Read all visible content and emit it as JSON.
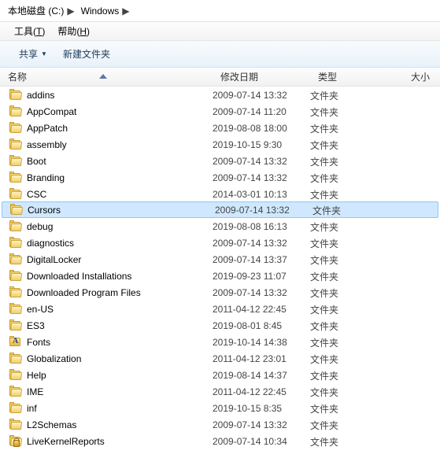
{
  "breadcrumb": {
    "seg1": "本地磁盘 (C:)",
    "seg2": "Windows"
  },
  "menubar": {
    "tools_pre": "工具(",
    "tools_key": "T",
    "tools_post": ")",
    "help_pre": "帮助(",
    "help_key": "H",
    "help_post": ")"
  },
  "toolbar": {
    "share": "共享",
    "newfolder": "新建文件夹"
  },
  "columns": {
    "name": "名称",
    "date": "修改日期",
    "type": "类型",
    "size": "大小"
  },
  "type_folder": "文件夹",
  "rows": [
    {
      "name": "addins",
      "date": "2009-07-14 13:32",
      "icon": "folder",
      "selected": false
    },
    {
      "name": "AppCompat",
      "date": "2009-07-14 11:20",
      "icon": "folder",
      "selected": false
    },
    {
      "name": "AppPatch",
      "date": "2019-08-08 18:00",
      "icon": "folder",
      "selected": false
    },
    {
      "name": "assembly",
      "date": "2019-10-15 9:30",
      "icon": "folder",
      "selected": false
    },
    {
      "name": "Boot",
      "date": "2009-07-14 13:32",
      "icon": "folder",
      "selected": false
    },
    {
      "name": "Branding",
      "date": "2009-07-14 13:32",
      "icon": "folder",
      "selected": false
    },
    {
      "name": "CSC",
      "date": "2014-03-01 10:13",
      "icon": "folder",
      "selected": false
    },
    {
      "name": "Cursors",
      "date": "2009-07-14 13:32",
      "icon": "folder",
      "selected": true
    },
    {
      "name": "debug",
      "date": "2019-08-08 16:13",
      "icon": "folder",
      "selected": false
    },
    {
      "name": "diagnostics",
      "date": "2009-07-14 13:32",
      "icon": "folder",
      "selected": false
    },
    {
      "name": "DigitalLocker",
      "date": "2009-07-14 13:37",
      "icon": "folder",
      "selected": false
    },
    {
      "name": "Downloaded Installations",
      "date": "2019-09-23 11:07",
      "icon": "folder",
      "selected": false
    },
    {
      "name": "Downloaded Program Files",
      "date": "2009-07-14 13:32",
      "icon": "folder",
      "selected": false
    },
    {
      "name": "en-US",
      "date": "2011-04-12 22:45",
      "icon": "folder",
      "selected": false
    },
    {
      "name": "ES3",
      "date": "2019-08-01 8:45",
      "icon": "folder",
      "selected": false
    },
    {
      "name": "Fonts",
      "date": "2019-10-14 14:38",
      "icon": "fonts",
      "selected": false
    },
    {
      "name": "Globalization",
      "date": "2011-04-12 23:01",
      "icon": "folder",
      "selected": false
    },
    {
      "name": "Help",
      "date": "2019-08-14 14:37",
      "icon": "folder",
      "selected": false
    },
    {
      "name": "IME",
      "date": "2011-04-12 22:45",
      "icon": "folder",
      "selected": false
    },
    {
      "name": "inf",
      "date": "2019-10-15 8:35",
      "icon": "folder",
      "selected": false
    },
    {
      "name": "L2Schemas",
      "date": "2009-07-14 13:32",
      "icon": "folder",
      "selected": false
    },
    {
      "name": "LiveKernelReports",
      "date": "2009-07-14 10:34",
      "icon": "locked",
      "selected": false
    }
  ]
}
